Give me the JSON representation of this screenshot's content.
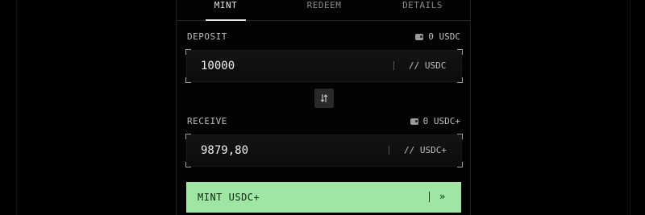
{
  "tabs": {
    "mint": "MINT",
    "redeem": "REDEEM",
    "details": "DETAILS",
    "active": "MINT"
  },
  "deposit": {
    "label": "DEPOSIT",
    "balance": "0 USDC",
    "value": "10000",
    "unit": "// USDC"
  },
  "receive": {
    "label": "RECEIVE",
    "balance": "0 USDC+",
    "value": "9879,80",
    "unit": "// USDC+"
  },
  "action": {
    "label": "MINT USDC+",
    "arrow": "»",
    "color": "#9ee6a1"
  },
  "icons": {
    "balance": "wallet-icon",
    "swap": "swap-arrows-icon",
    "submit": "double-chevron-right-icon"
  }
}
